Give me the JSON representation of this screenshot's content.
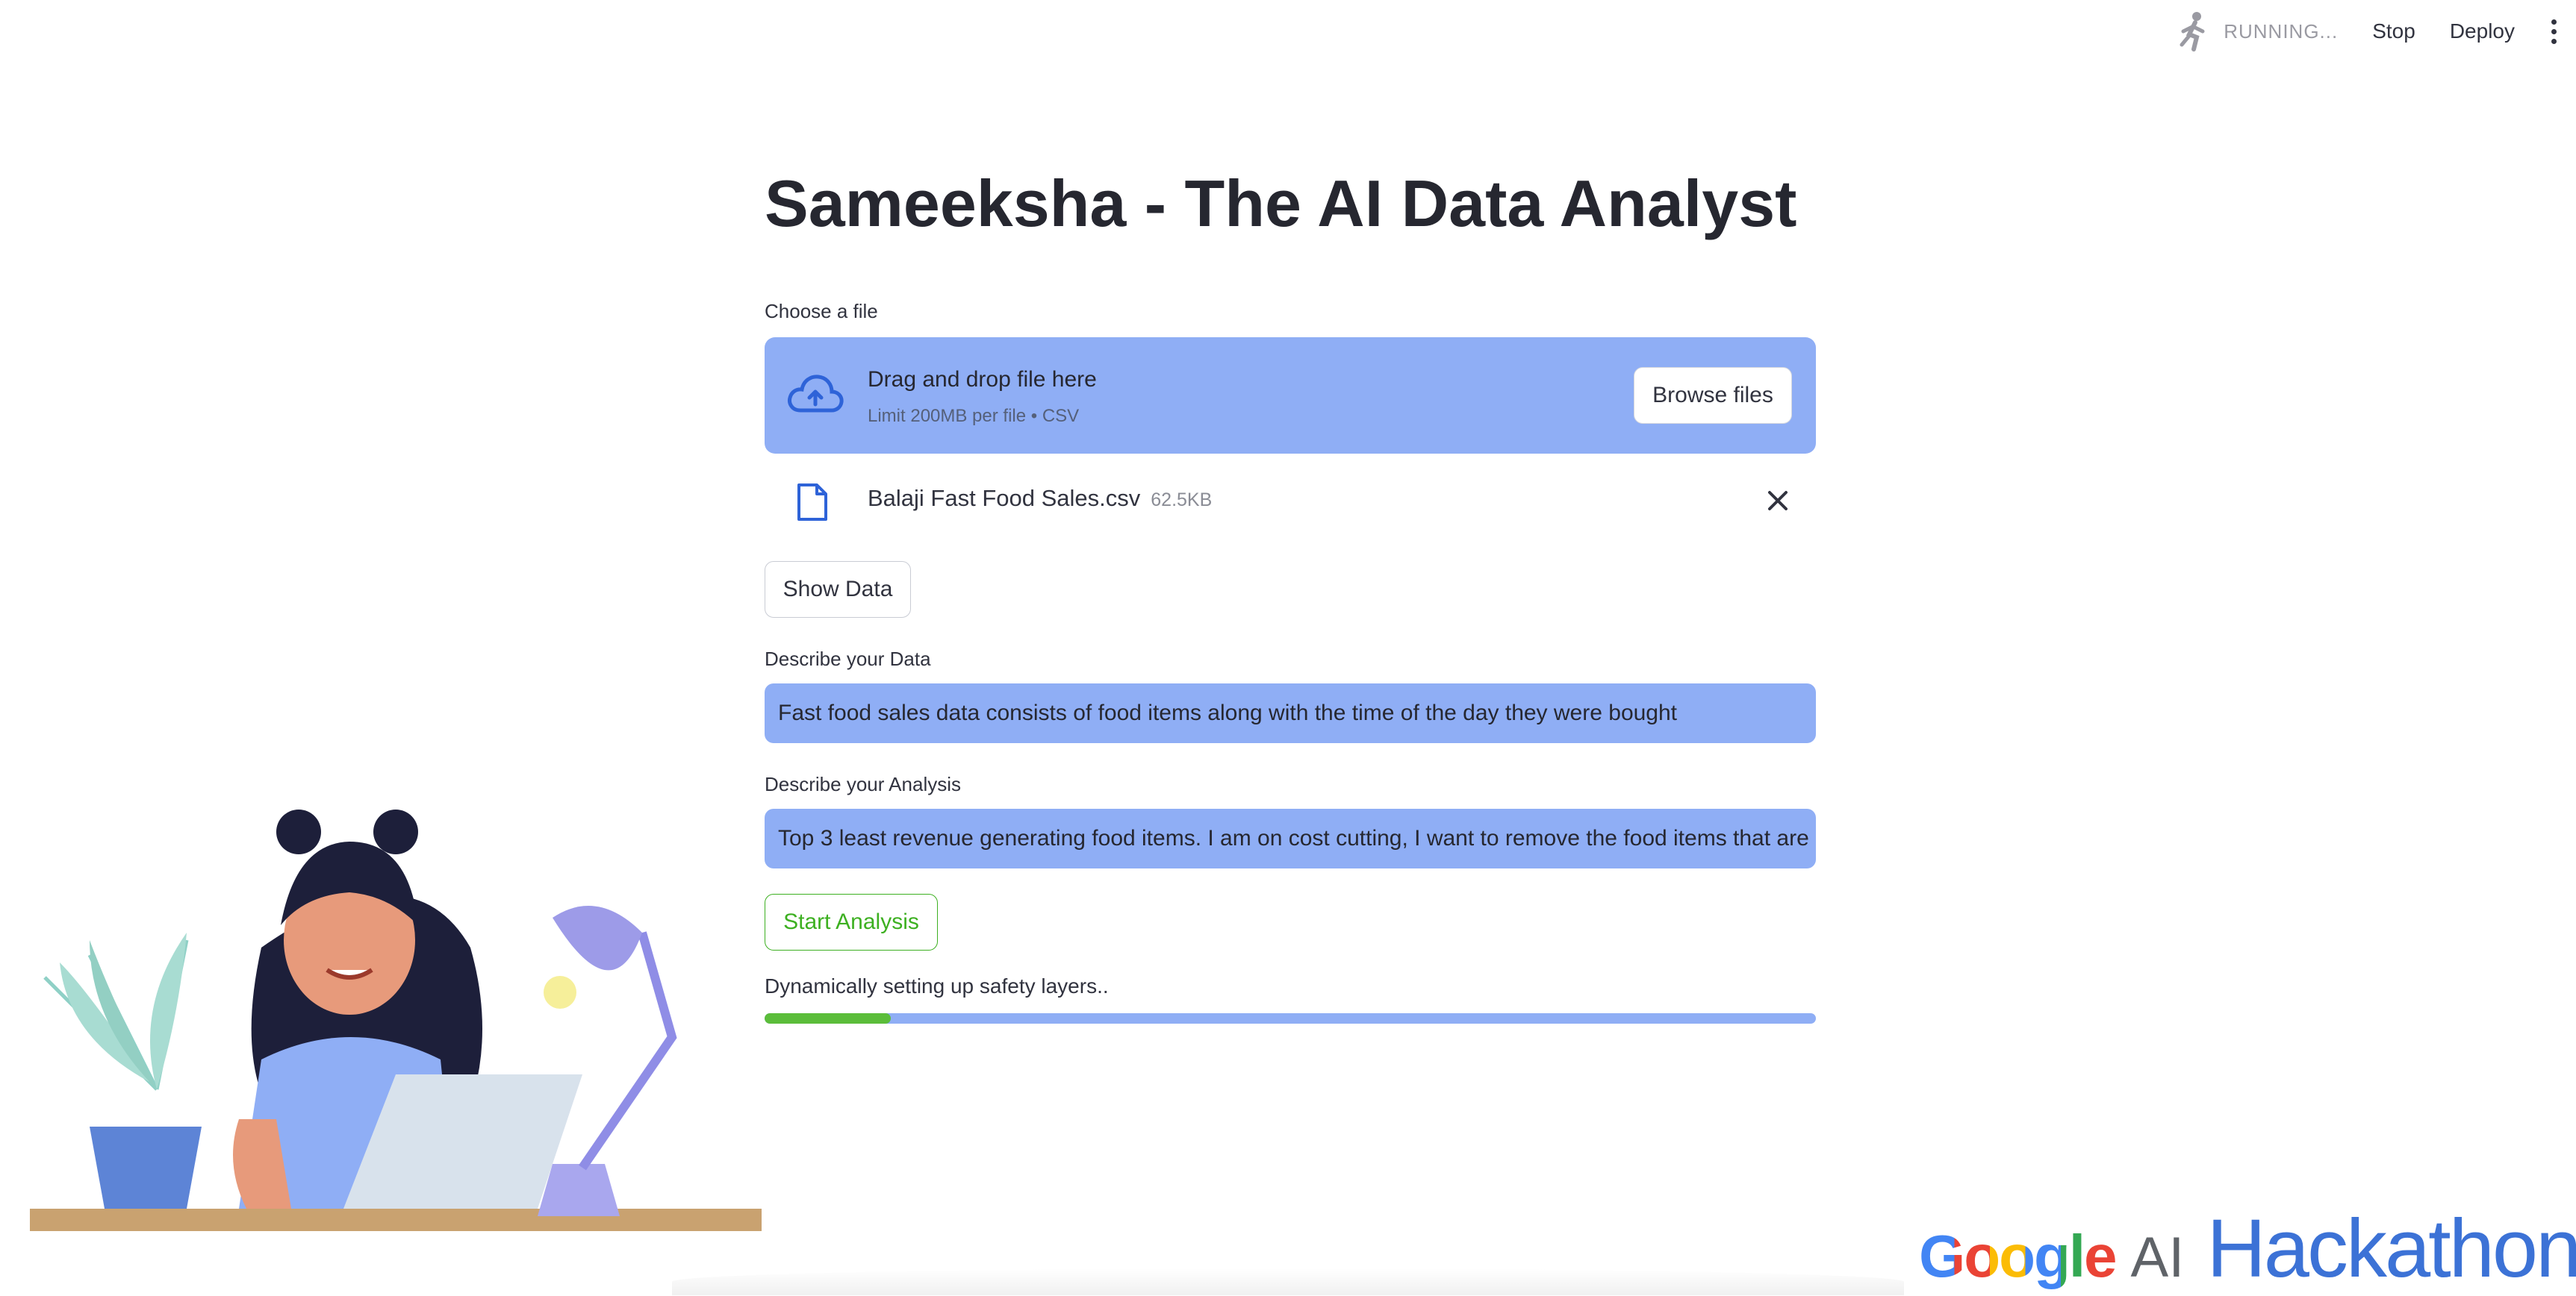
{
  "toolbar": {
    "status": "RUNNING...",
    "stop_label": "Stop",
    "deploy_label": "Deploy"
  },
  "page_title": "Sameeksha - The AI Data Analyst",
  "uploader": {
    "label": "Choose a file",
    "drag_text": "Drag and drop file here",
    "limit_text": "Limit 200MB per file • CSV",
    "browse_label": "Browse files",
    "file_name": "Balaji Fast Food Sales.csv",
    "file_size": "62.5KB"
  },
  "show_data_label": "Show Data",
  "describe_data": {
    "label": "Describe your Data",
    "value": "Fast food sales data consists of food items along with the time of the day they were bought"
  },
  "describe_analysis": {
    "label": "Describe your Analysis",
    "value": "Top 3 least revenue generating food items. I am on cost cutting, I want to remove the food items that are"
  },
  "start_analysis_label": "Start Analysis",
  "progress": {
    "label": "Dynamically setting up safety layers..",
    "value_percent": 12
  },
  "logo": {
    "google": "Google",
    "ai": "AI",
    "hackathon": "Hackathon"
  },
  "colors": {
    "accent_blue": "#8faef5",
    "progress_green": "#5bbd3a",
    "button_green": "#3db021"
  }
}
